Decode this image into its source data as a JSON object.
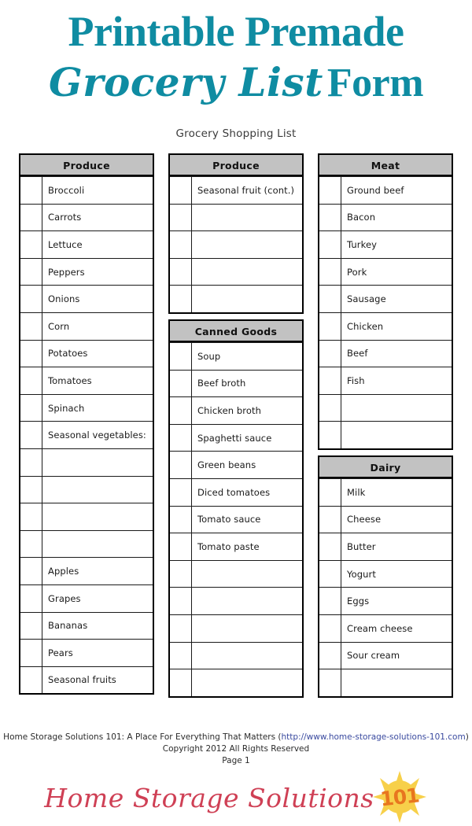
{
  "header": {
    "title_line1": "Printable Premade",
    "title_script": "Grocery List",
    "title_form": "Form",
    "subtitle": "Grocery Shopping List",
    "accent_color": "#0f8ca2"
  },
  "columns": [
    {
      "tables": [
        {
          "heading": "Produce",
          "rows": [
            "Broccoli",
            "Carrots",
            "Lettuce",
            "Peppers",
            "Onions",
            "Corn",
            "Potatoes",
            "Tomatoes",
            "Spinach",
            "Seasonal vegetables:",
            "",
            "",
            "",
            "",
            "Apples",
            "Grapes",
            "Bananas",
            "Pears",
            "Seasonal fruits"
          ]
        }
      ]
    },
    {
      "tables": [
        {
          "heading": "Produce",
          "rows": [
            "Seasonal fruit (cont.)",
            "",
            "",
            "",
            ""
          ]
        },
        {
          "heading": "Canned Goods",
          "rows": [
            "Soup",
            "Beef broth",
            "Chicken broth",
            "Spaghetti sauce",
            "Green beans",
            "Diced tomatoes",
            "Tomato sauce",
            "Tomato paste",
            "",
            "",
            "",
            "",
            ""
          ]
        }
      ]
    },
    {
      "tables": [
        {
          "heading": "Meat",
          "rows": [
            "Ground beef",
            "Bacon",
            "Turkey",
            "Pork",
            "Sausage",
            "Chicken",
            "Beef",
            "Fish",
            "",
            ""
          ]
        },
        {
          "heading": "Dairy",
          "rows": [
            "Milk",
            "Cheese",
            "Butter",
            "Yogurt",
            "Eggs",
            "Cream cheese",
            "Sour cream",
            ""
          ]
        }
      ]
    }
  ],
  "footer": {
    "line1_prefix": "Home Storage Solutions 101: A Place For Everything That Matters (",
    "line1_url": "http://www.home-storage-solutions-101.com",
    "line1_suffix": ")",
    "line2": "Copyright 2012 All Rights Reserved",
    "line3": "Page 1",
    "url_color": "#3a4a9f"
  },
  "logo": {
    "text": "Home Storage Solutions",
    "badge": "101",
    "text_color": "#cf4055",
    "sun_color": "#f7d04a",
    "badge_color": "#e8761f"
  }
}
